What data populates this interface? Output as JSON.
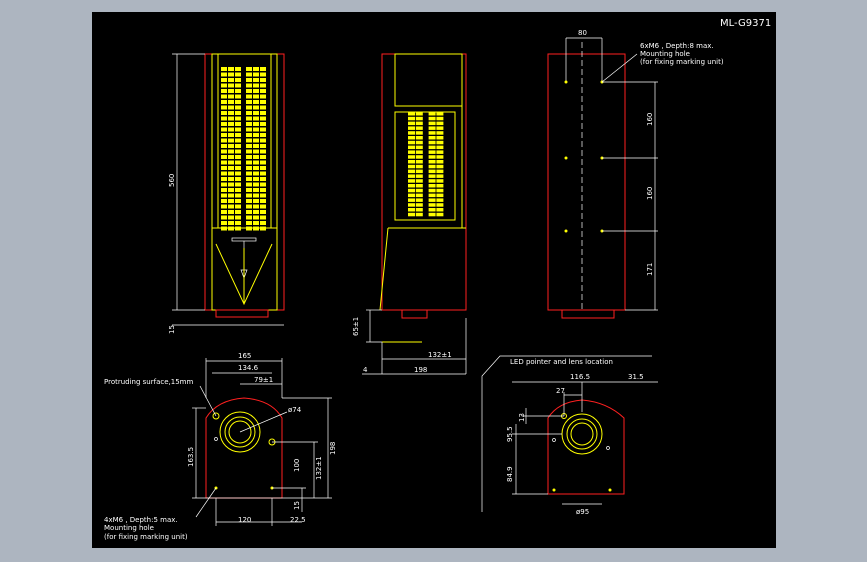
{
  "title": "ML-G9371",
  "labels": {
    "mount_top": "6xM6 , Depth:8 max.",
    "mount_top_2": "Mounting hole",
    "mount_top_3": "(for fixing marking unit)",
    "protruding": "Protruding surface,15mm",
    "mount_bottom": "4xM6 , Depth:5 max.",
    "mount_bottom_2": "Mounting hole",
    "mount_bottom_3": "(for fixing marking unit)",
    "led_pointer": "LED pointer and lens location"
  },
  "dims": {
    "front_height": "560",
    "front_bottom": "15",
    "top_width": "80",
    "hole_1": "160",
    "hole_2": "160",
    "hole_3": "171",
    "side_small": "65±1",
    "side_132": "132±1",
    "side_4": "4",
    "side_198": "198",
    "bot_165": "165",
    "bot_134": "134.6",
    "bot_79": "79±1",
    "bot_phi74": "ø74",
    "bot_1635": "163.5",
    "bot_198": "198",
    "bot_132": "132±1",
    "bot_100": "100",
    "bot_15": "15",
    "bot_120": "120",
    "bot_225": "22.5",
    "r_1165": "116.5",
    "r_315": "31.5",
    "r_27": "27",
    "r_13": "13",
    "r_955": "95.5",
    "r_849": "84.9",
    "r_phi95": "ø95"
  },
  "colors": {
    "background": "#000000",
    "outline": "#ff2020",
    "detail": "#ffff00",
    "dimension": "#ffffff",
    "frame": "#adb5c0"
  }
}
